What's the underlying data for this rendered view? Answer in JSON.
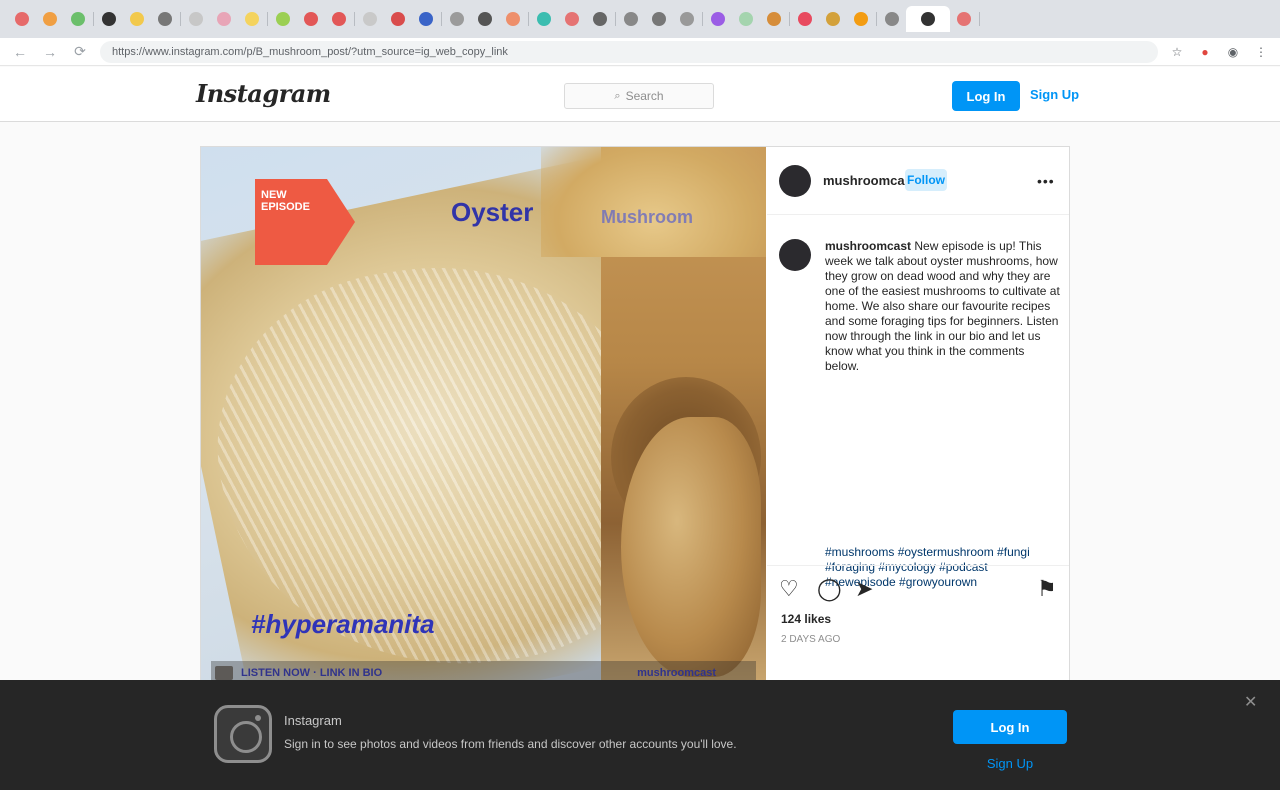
{
  "browser": {
    "tab_colors": [
      "#e66a6a",
      "#f09f43",
      "#6bbf6b",
      "#333333",
      "#f2c94c",
      "#777777",
      "#c7c7c7",
      "#e8a5b7",
      "#f4d35e",
      "#9bcf53",
      "#e25757",
      "#e25757",
      "#c9c9c9",
      "#d94c4c",
      "#3a64c8",
      "#9b9b9b",
      "#555555",
      "#ee8f6b",
      "#3bbdb0",
      "#e57373",
      "#666666",
      "#888888",
      "#777777",
      "#999999",
      "#9b5de5",
      "#a4d4ae",
      "#d68d3a",
      "#e84a5f",
      "#d3a13b",
      "#f39c12",
      "#888888",
      "#333333",
      "#e57373"
    ],
    "url": "https://www.instagram.com/p/B_mushroom_post/?utm_source=ig_web_copy_link",
    "nav": {
      "back": "←",
      "forward": "→",
      "reload": "⟳"
    }
  },
  "ig_header": {
    "logo": "Instagram",
    "search_placeholder": "Search",
    "login_label": "Log In",
    "signup_label": "Sign Up"
  },
  "post": {
    "sticker_text": "NEW\nEPISODE",
    "overlay_title": "Oyster",
    "overlay_title2": "Mushroom",
    "overlay_script": "#hyperamanita",
    "footer_left": "LISTEN NOW · LINK IN BIO",
    "footer_right": "mushroomcast",
    "username": "mushroomcast",
    "follow_label": "Follow",
    "more_label": "•••",
    "caption_user": "mushroomcast",
    "caption_body": "New episode is up! This week we talk about oyster mushrooms, how they grow on dead wood and why they are one of the easiest mushrooms to cultivate at home. We also share our favourite recipes and some foraging tips for beginners. Listen now through the link in our bio and let us know what you think in the comments below.",
    "caption_tags": "#mushrooms #oystermushroom #fungi #foraging #mycology #podcast #newepisode #growyourown",
    "caption_time": "2d",
    "likes": "124 likes",
    "date": "2 days ago"
  },
  "banner": {
    "title": "Instagram",
    "subtitle": "Sign in to see photos and videos from friends and discover other accounts you'll love.",
    "cta_label": "Log In",
    "dismiss_label": "Sign Up",
    "close_label": "✕"
  }
}
